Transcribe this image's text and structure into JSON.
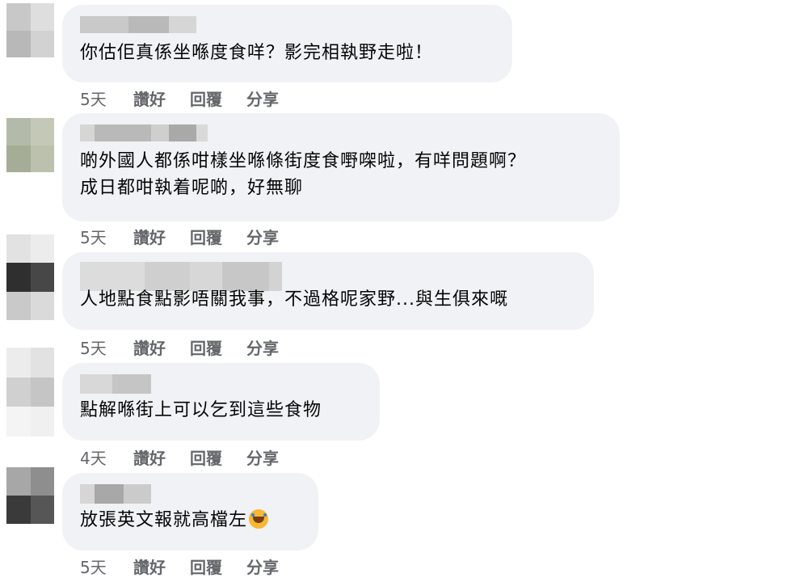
{
  "comments": [
    {
      "text_lines": [
        "你估佢真係坐喺度食咩？影完相執野走啦！"
      ],
      "time": "5天"
    },
    {
      "text_lines": [
        "啲外國人都係咁樣坐喺條街度食嘢㗎啦，有咩問題啊？",
        "成日都咁執着呢啲，好無聊"
      ],
      "time": "5天"
    },
    {
      "text_lines": [
        "人地點食點影唔關我事，不過格呢家野...與生俱來嘅"
      ],
      "time": "5天"
    },
    {
      "text_lines": [
        "點解喺街上可以乞到這些食物"
      ],
      "time": "4天"
    },
    {
      "text_lines": [
        "放張英文報就高檔左"
      ],
      "time": "5天",
      "emoji": "rolling-on-floor-laughing"
    }
  ],
  "actions": {
    "like": "讚好",
    "reply": "回覆",
    "share": "分享"
  }
}
